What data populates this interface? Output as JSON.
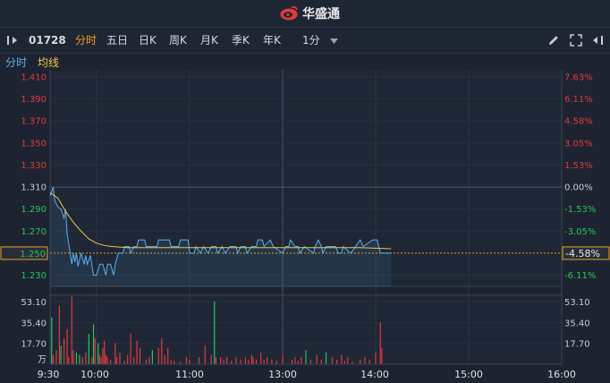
{
  "header": {
    "logo_text": "华盛通"
  },
  "toolbar": {
    "stock_code": "01728",
    "tabs": [
      {
        "label": "分时",
        "active": true
      },
      {
        "label": "五日",
        "active": false
      },
      {
        "label": "日K",
        "active": false
      },
      {
        "label": "周K",
        "active": false
      },
      {
        "label": "月K",
        "active": false
      },
      {
        "label": "季K",
        "active": false
      },
      {
        "label": "年K",
        "active": false
      }
    ],
    "interval": "1分"
  },
  "legend": {
    "price_label": "分时",
    "avg_label": "均线"
  },
  "colors": {
    "up": "#e23a3a",
    "down": "#2ec25b",
    "neutral": "#c8ccd2",
    "price_line": "#5ab0f0",
    "avg_line": "#f0c848",
    "active_tab": "#f0a020",
    "current_price": "#f0a020"
  },
  "chart_data": {
    "type": "line",
    "prev_close": 1.31,
    "current_price": "1.250",
    "current_pct": "-4.58%",
    "price_ticks": [
      "1.410",
      "1.390",
      "1.370",
      "1.350",
      "1.330",
      "1.310",
      "1.290",
      "1.270",
      "1.250",
      "1.230"
    ],
    "pct_ticks": [
      "7.63%",
      "6.11%",
      "4.58%",
      "3.05%",
      "1.53%",
      "0.00%",
      "-1.53%",
      "-3.05%",
      "-4.58%",
      "-6.11%"
    ],
    "volume_ticks": [
      "53.10",
      "35.40",
      "17.70"
    ],
    "volume_unit": "万",
    "x_ticks": [
      "9:30",
      "10:00",
      "11:00",
      "13:00",
      "14:00",
      "15:00",
      "16:00"
    ],
    "price": [
      [
        0,
        1.302
      ],
      [
        2,
        1.31
      ],
      [
        3,
        1.298
      ],
      [
        5,
        1.292
      ],
      [
        7,
        1.29
      ],
      [
        9,
        1.282
      ],
      [
        10,
        1.29
      ],
      [
        11,
        1.268
      ],
      [
        13,
        1.25
      ],
      [
        14,
        1.24
      ],
      [
        15,
        1.25
      ],
      [
        16,
        1.242
      ],
      [
        17,
        1.25
      ],
      [
        18,
        1.238
      ],
      [
        20,
        1.25
      ],
      [
        22,
        1.24
      ],
      [
        23,
        1.248
      ],
      [
        24,
        1.24
      ],
      [
        26,
        1.248
      ],
      [
        28,
        1.23
      ],
      [
        30,
        1.23
      ],
      [
        32,
        1.24
      ],
      [
        34,
        1.24
      ],
      [
        36,
        1.23
      ],
      [
        37,
        1.24
      ],
      [
        39,
        1.24
      ],
      [
        41,
        1.23
      ],
      [
        42,
        1.24
      ],
      [
        44,
        1.25
      ],
      [
        47,
        1.25
      ],
      [
        48,
        1.256
      ],
      [
        51,
        1.256
      ],
      [
        52,
        1.25
      ],
      [
        54,
        1.256
      ],
      [
        56,
        1.256
      ],
      [
        57,
        1.262
      ],
      [
        61,
        1.262
      ],
      [
        62,
        1.256
      ],
      [
        69,
        1.256
      ],
      [
        70,
        1.262
      ],
      [
        77,
        1.262
      ],
      [
        78,
        1.256
      ],
      [
        83,
        1.256
      ],
      [
        84,
        1.262
      ],
      [
        89,
        1.262
      ],
      [
        90,
        1.25
      ],
      [
        93,
        1.25
      ],
      [
        94,
        1.256
      ],
      [
        97,
        1.25
      ],
      [
        99,
        1.256
      ],
      [
        102,
        1.25
      ],
      [
        104,
        1.256
      ],
      [
        107,
        1.256
      ],
      [
        108,
        1.25
      ],
      [
        111,
        1.256
      ],
      [
        113,
        1.25
      ],
      [
        116,
        1.256
      ],
      [
        120,
        1.256
      ],
      [
        121,
        1.25
      ],
      [
        123,
        1.256
      ],
      [
        126,
        1.256
      ],
      [
        127,
        1.25
      ],
      [
        130,
        1.256
      ],
      [
        133,
        1.256
      ],
      [
        134,
        1.262
      ],
      [
        137,
        1.262
      ],
      [
        138,
        1.256
      ],
      [
        142,
        1.262
      ],
      [
        144,
        1.256
      ],
      [
        150,
        1.25
      ],
      [
        152,
        1.256
      ],
      [
        154,
        1.256
      ],
      [
        155,
        1.262
      ],
      [
        158,
        1.256
      ],
      [
        160,
        1.256
      ],
      [
        161,
        1.25
      ],
      [
        164,
        1.256
      ],
      [
        170,
        1.25
      ],
      [
        171,
        1.256
      ],
      [
        173,
        1.262
      ],
      [
        175,
        1.256
      ],
      [
        176,
        1.25
      ],
      [
        178,
        1.256
      ],
      [
        184,
        1.256
      ],
      [
        186,
        1.25
      ],
      [
        188,
        1.25
      ],
      [
        189,
        1.256
      ],
      [
        194,
        1.25
      ],
      [
        197,
        1.256
      ],
      [
        200,
        1.262
      ],
      [
        202,
        1.256
      ],
      [
        208,
        1.262
      ],
      [
        211,
        1.262
      ],
      [
        212,
        1.256
      ],
      [
        213,
        1.25
      ],
      [
        220,
        1.25
      ]
    ],
    "avg": [
      [
        0,
        1.305
      ],
      [
        5,
        1.3
      ],
      [
        10,
        1.288
      ],
      [
        15,
        1.278
      ],
      [
        20,
        1.27
      ],
      [
        25,
        1.263
      ],
      [
        30,
        1.259
      ],
      [
        35,
        1.257
      ],
      [
        40,
        1.256
      ],
      [
        50,
        1.255
      ],
      [
        60,
        1.255
      ],
      [
        80,
        1.255
      ],
      [
        100,
        1.255
      ],
      [
        120,
        1.255
      ],
      [
        150,
        1.255
      ],
      [
        180,
        1.255
      ],
      [
        200,
        1.255
      ],
      [
        220,
        1.254
      ]
    ],
    "volume": [
      [
        1,
        40,
        "down"
      ],
      [
        2,
        8,
        "up"
      ],
      [
        4,
        12,
        "up"
      ],
      [
        6,
        50,
        "up"
      ],
      [
        7,
        16,
        "down"
      ],
      [
        9,
        22,
        "up"
      ],
      [
        11,
        30,
        "up"
      ],
      [
        12,
        6,
        "up"
      ],
      [
        14,
        58,
        "up"
      ],
      [
        15,
        12,
        "up"
      ],
      [
        17,
        10,
        "down"
      ],
      [
        19,
        8,
        "down"
      ],
      [
        21,
        6,
        "up"
      ],
      [
        23,
        10,
        "up"
      ],
      [
        25,
        26,
        "down"
      ],
      [
        27,
        6,
        "up"
      ],
      [
        28,
        34,
        "down"
      ],
      [
        29,
        22,
        "up"
      ],
      [
        31,
        18,
        "down"
      ],
      [
        32,
        8,
        "up"
      ],
      [
        33,
        6,
        "up"
      ],
      [
        34,
        14,
        "up"
      ],
      [
        35,
        20,
        "up"
      ],
      [
        36,
        8,
        "up"
      ],
      [
        37,
        6,
        "up"
      ],
      [
        39,
        4,
        "up"
      ],
      [
        42,
        18,
        "up"
      ],
      [
        43,
        6,
        "up"
      ],
      [
        45,
        10,
        "up"
      ],
      [
        48,
        3,
        "up"
      ],
      [
        50,
        8,
        "up"
      ],
      [
        52,
        26,
        "up"
      ],
      [
        54,
        6,
        "up"
      ],
      [
        56,
        20,
        "up"
      ],
      [
        58,
        14,
        "up"
      ],
      [
        62,
        4,
        "up"
      ],
      [
        64,
        6,
        "up"
      ],
      [
        66,
        12,
        "down"
      ],
      [
        70,
        14,
        "up"
      ],
      [
        72,
        22,
        "up"
      ],
      [
        74,
        8,
        "up"
      ],
      [
        76,
        14,
        "up"
      ],
      [
        78,
        4,
        "up"
      ],
      [
        80,
        3,
        "up"
      ],
      [
        84,
        2,
        "up"
      ],
      [
        88,
        6,
        "up"
      ],
      [
        90,
        4,
        "up"
      ],
      [
        96,
        6,
        "up"
      ],
      [
        100,
        16,
        "up"
      ],
      [
        104,
        8,
        "up"
      ],
      [
        106,
        54,
        "down"
      ],
      [
        107,
        6,
        "up"
      ],
      [
        110,
        6,
        "up"
      ],
      [
        112,
        4,
        "up"
      ],
      [
        114,
        6,
        "up"
      ],
      [
        117,
        3,
        "up"
      ],
      [
        120,
        6,
        "up"
      ],
      [
        123,
        4,
        "up"
      ],
      [
        126,
        6,
        "up"
      ],
      [
        128,
        4,
        "up"
      ],
      [
        130,
        8,
        "up"
      ],
      [
        131,
        6,
        "up"
      ],
      [
        133,
        4,
        "up"
      ],
      [
        136,
        10,
        "up"
      ],
      [
        138,
        4,
        "up"
      ],
      [
        140,
        6,
        "up"
      ],
      [
        143,
        4,
        "up"
      ],
      [
        146,
        3,
        "up"
      ],
      [
        150,
        8,
        "up"
      ],
      [
        156,
        4,
        "up"
      ],
      [
        158,
        6,
        "up"
      ],
      [
        160,
        3,
        "up"
      ],
      [
        162,
        6,
        "up"
      ],
      [
        165,
        12,
        "down"
      ],
      [
        168,
        4,
        "up"
      ],
      [
        172,
        8,
        "up"
      ],
      [
        175,
        4,
        "up"
      ],
      [
        178,
        10,
        "down"
      ],
      [
        182,
        6,
        "up"
      ],
      [
        185,
        4,
        "up"
      ],
      [
        188,
        8,
        "up"
      ],
      [
        190,
        3,
        "up"
      ],
      [
        192,
        6,
        "up"
      ],
      [
        195,
        2,
        "up"
      ],
      [
        200,
        4,
        "up"
      ],
      [
        203,
        6,
        "up"
      ],
      [
        206,
        4,
        "up"
      ],
      [
        210,
        10,
        "up"
      ],
      [
        213,
        36,
        "up"
      ],
      [
        214,
        14,
        "up"
      ]
    ]
  }
}
